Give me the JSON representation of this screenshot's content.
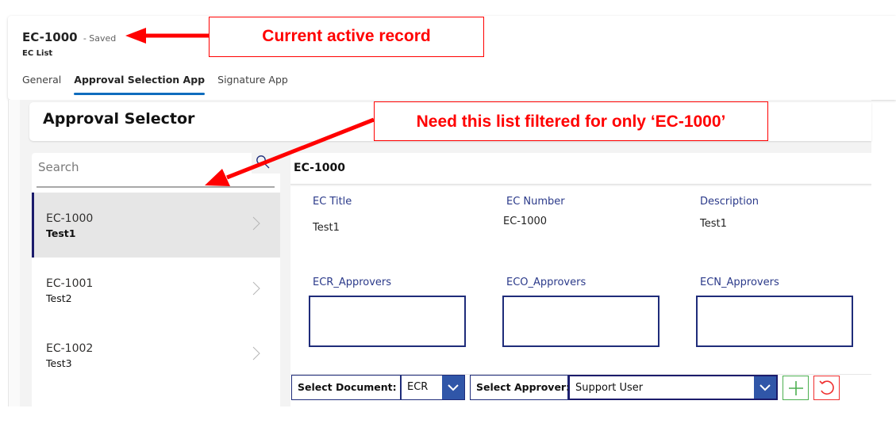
{
  "record": {
    "title": "EC-1000",
    "status": "- Saved",
    "entity": "EC List"
  },
  "tabs": [
    {
      "label": "General",
      "active": false
    },
    {
      "label": "Approval Selection App",
      "active": true
    },
    {
      "label": "Signature App",
      "active": false
    }
  ],
  "app": {
    "title": "Approval Selector",
    "search": {
      "placeholder": "Search",
      "value": ""
    },
    "gallery": [
      {
        "number": "EC-1000",
        "title": "Test1",
        "selected": true
      },
      {
        "number": "EC-1001",
        "title": "Test2",
        "selected": false
      },
      {
        "number": "EC-1002",
        "title": "Test3",
        "selected": false
      }
    ],
    "detail": {
      "header": "EC-1000",
      "fields": [
        {
          "label": "EC Title",
          "value": "Test1"
        },
        {
          "label": "EC Number",
          "value": "EC-1000"
        },
        {
          "label": "Description",
          "value": "Test1"
        }
      ],
      "approvers": [
        {
          "label": "ECR_Approvers",
          "value": ""
        },
        {
          "label": "ECO_Approvers",
          "value": ""
        },
        {
          "label": "ECN_Approvers",
          "value": ""
        }
      ]
    },
    "controls": {
      "document_label": "Select Document:",
      "document_value": "ECR",
      "approver_label": "Select Approver:",
      "approver_value": "Support User",
      "add_icon": "plus-icon",
      "reset_icon": "undo-icon"
    }
  },
  "annotations": {
    "active_record": "Current active record",
    "filter_note": "Need this list filtered for only ‘EC-1000’",
    "color": "#ff0000"
  }
}
